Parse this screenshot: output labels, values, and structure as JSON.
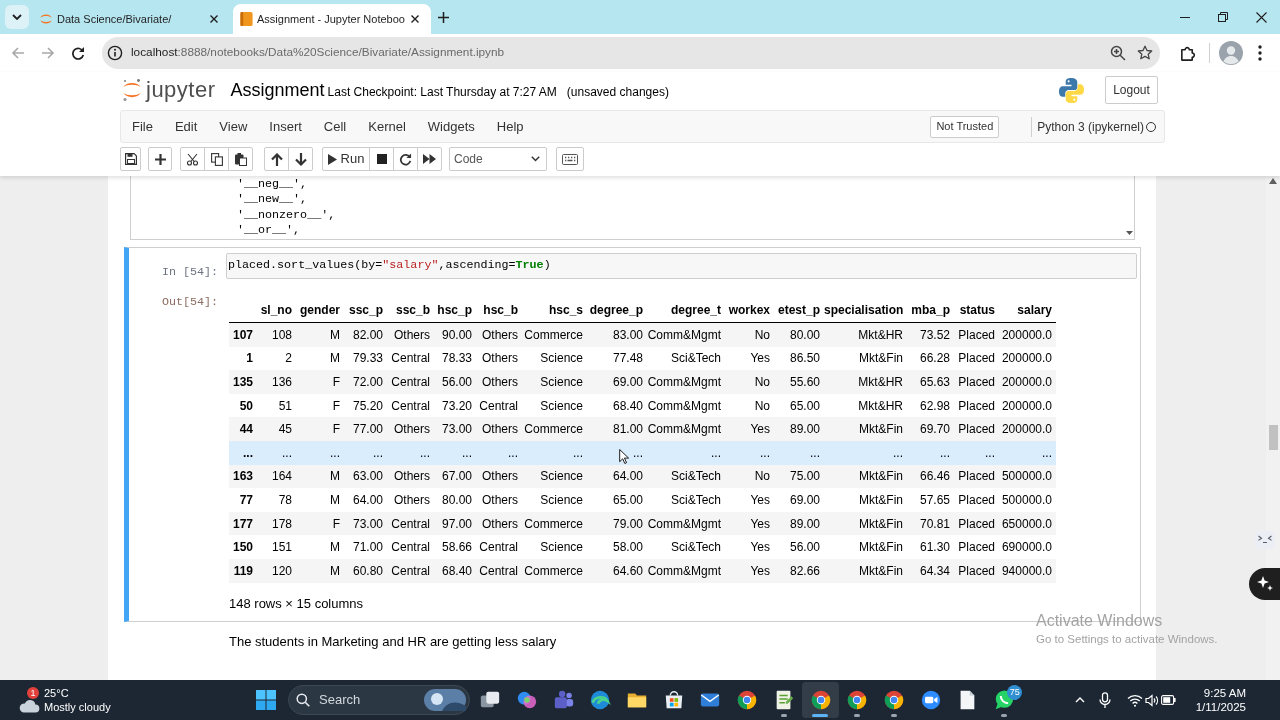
{
  "browser": {
    "tabs": [
      {
        "kind": "tree",
        "title": "Data Science/Bivariate/",
        "selected": false
      },
      {
        "kind": "notebook",
        "title": "Assignment - Jupyter Noteboo",
        "selected": true
      }
    ],
    "nav": {
      "back_disabled": true,
      "forward_disabled": true
    },
    "address": {
      "host": "localhost",
      "path": ":8888/notebooks/Data%20Science/Bivariate/Assignment.ipynb"
    }
  },
  "header": {
    "logo_text": "jupyter",
    "title": "Assignment",
    "checkpoint": "Last Checkpoint: Last Thursday at 7:27 AM",
    "save_status": "(unsaved changes)",
    "logout": "Logout"
  },
  "menu": {
    "items": [
      "File",
      "Edit",
      "View",
      "Insert",
      "Cell",
      "Kernel",
      "Widgets",
      "Help"
    ],
    "trust": "Not Trusted",
    "kernel": "Python 3 (ipykernel)",
    "kernel_busy": false
  },
  "toolbar": {
    "run": "Run",
    "cell_type": "Code"
  },
  "previous_output": {
    "lines": [
      "'__neg__',",
      "'__new__',",
      "'__nonzero__',",
      "'__or__',"
    ]
  },
  "cell": {
    "selected": true,
    "in_prompt": "In [54]:",
    "code": [
      {
        "kind": "plain",
        "text": "placed.sort_values(by="
      },
      {
        "kind": "string",
        "text": "\"salary\""
      },
      {
        "kind": "plain",
        "text": ",ascending="
      },
      {
        "kind": "keyword",
        "text": "True"
      },
      {
        "kind": "plain",
        "text": ")"
      }
    ],
    "out_prompt": "Out[54]:",
    "table": {
      "columns": [
        "sl_no",
        "gender",
        "ssc_p",
        "ssc_b",
        "hsc_p",
        "hsc_b",
        "hsc_s",
        "degree_p",
        "degree_t",
        "workex",
        "etest_p",
        "specialisation",
        "mba_p",
        "status",
        "salary"
      ],
      "rows": [
        {
          "index": "107",
          "highlighted": false,
          "cells": [
            "108",
            "M",
            "82.00",
            "Others",
            "90.00",
            "Others",
            "Commerce",
            "83.00",
            "Comm&Mgmt",
            "No",
            "80.00",
            "Mkt&HR",
            "73.52",
            "Placed",
            "200000.0"
          ]
        },
        {
          "index": "1",
          "highlighted": false,
          "cells": [
            "2",
            "M",
            "79.33",
            "Central",
            "78.33",
            "Others",
            "Science",
            "77.48",
            "Sci&Tech",
            "Yes",
            "86.50",
            "Mkt&Fin",
            "66.28",
            "Placed",
            "200000.0"
          ]
        },
        {
          "index": "135",
          "highlighted": false,
          "cells": [
            "136",
            "F",
            "72.00",
            "Central",
            "56.00",
            "Others",
            "Science",
            "69.00",
            "Comm&Mgmt",
            "No",
            "55.60",
            "Mkt&HR",
            "65.63",
            "Placed",
            "200000.0"
          ]
        },
        {
          "index": "50",
          "highlighted": false,
          "cells": [
            "51",
            "F",
            "75.20",
            "Central",
            "73.20",
            "Central",
            "Science",
            "68.40",
            "Comm&Mgmt",
            "No",
            "65.00",
            "Mkt&HR",
            "62.98",
            "Placed",
            "200000.0"
          ]
        },
        {
          "index": "44",
          "highlighted": false,
          "cells": [
            "45",
            "F",
            "77.00",
            "Others",
            "73.00",
            "Others",
            "Commerce",
            "81.00",
            "Comm&Mgmt",
            "Yes",
            "89.00",
            "Mkt&Fin",
            "69.70",
            "Placed",
            "200000.0"
          ]
        },
        {
          "index": "...",
          "highlighted": true,
          "cells": [
            "...",
            "...",
            "...",
            "...",
            "...",
            "...",
            "...",
            "...",
            "...",
            "...",
            "...",
            "...",
            "...",
            "...",
            "..."
          ]
        },
        {
          "index": "163",
          "highlighted": false,
          "cells": [
            "164",
            "M",
            "63.00",
            "Others",
            "67.00",
            "Others",
            "Science",
            "64.00",
            "Sci&Tech",
            "No",
            "75.00",
            "Mkt&Fin",
            "66.46",
            "Placed",
            "500000.0"
          ]
        },
        {
          "index": "77",
          "highlighted": false,
          "cells": [
            "78",
            "M",
            "64.00",
            "Others",
            "80.00",
            "Others",
            "Science",
            "65.00",
            "Sci&Tech",
            "Yes",
            "69.00",
            "Mkt&Fin",
            "57.65",
            "Placed",
            "500000.0"
          ]
        },
        {
          "index": "177",
          "highlighted": false,
          "cells": [
            "178",
            "F",
            "73.00",
            "Central",
            "97.00",
            "Others",
            "Commerce",
            "79.00",
            "Comm&Mgmt",
            "Yes",
            "89.00",
            "Mkt&Fin",
            "70.81",
            "Placed",
            "650000.0"
          ]
        },
        {
          "index": "150",
          "highlighted": false,
          "cells": [
            "151",
            "M",
            "71.00",
            "Central",
            "58.66",
            "Central",
            "Science",
            "58.00",
            "Sci&Tech",
            "Yes",
            "56.00",
            "Mkt&Fin",
            "61.30",
            "Placed",
            "690000.0"
          ]
        },
        {
          "index": "119",
          "highlighted": false,
          "cells": [
            "120",
            "M",
            "60.80",
            "Central",
            "68.40",
            "Central",
            "Commerce",
            "64.60",
            "Comm&Mgmt",
            "Yes",
            "82.66",
            "Mkt&Fin",
            "64.34",
            "Placed",
            "940000.0"
          ]
        }
      ]
    },
    "shape": "148 rows × 15 columns"
  },
  "markdown": "The students in Marketing and HR are getting less salary",
  "activation_notice": {
    "title": "Activate Windows",
    "hint": "Go to Settings to activate Windows."
  },
  "taskbar": {
    "weather": {
      "badge": "1",
      "temperature": "25°C",
      "condition": "Mostly cloudy"
    },
    "search": {
      "placeholder": "Search"
    },
    "apps": [
      {
        "kind": "panes",
        "running": false,
        "selected": false
      },
      {
        "kind": "swirl",
        "running": false,
        "selected": false
      },
      {
        "kind": "people",
        "running": false,
        "selected": false
      },
      {
        "kind": "wave",
        "running": false,
        "selected": false
      },
      {
        "kind": "folder",
        "running": false,
        "selected": false
      },
      {
        "kind": "bag",
        "running": false,
        "selected": false
      },
      {
        "kind": "envelope",
        "running": false,
        "selected": false
      },
      {
        "kind": "browser",
        "running": false,
        "selected": false
      },
      {
        "kind": "notepad",
        "running": true,
        "selected": false
      },
      {
        "kind": "browser",
        "running": true,
        "selected": true
      },
      {
        "kind": "browser",
        "running": true,
        "selected": false
      },
      {
        "kind": "browser",
        "running": true,
        "selected": false
      },
      {
        "kind": "camera",
        "running": false,
        "selected": false
      },
      {
        "kind": "document",
        "running": false,
        "selected": false
      },
      {
        "kind": "chat",
        "running": true,
        "selected": false,
        "badge": "75"
      }
    ],
    "clock": {
      "time": "9:25 AM",
      "date": "1/11/2025"
    }
  }
}
